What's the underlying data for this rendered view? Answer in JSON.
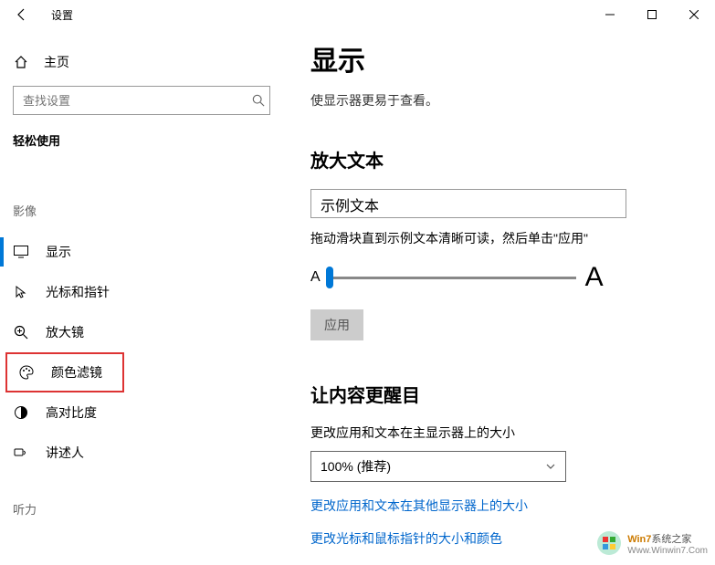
{
  "titlebar": {
    "app_name": "设置"
  },
  "sidebar": {
    "home_label": "主页",
    "search_placeholder": "查找设置",
    "section_label": "轻松使用",
    "category_vision": "影像",
    "category_hearing": "听力",
    "items": [
      {
        "label": "显示"
      },
      {
        "label": "光标和指针"
      },
      {
        "label": "放大镜"
      },
      {
        "label": "颜色滤镜"
      },
      {
        "label": "高对比度"
      },
      {
        "label": "讲述人"
      }
    ]
  },
  "content": {
    "page_title": "显示",
    "page_desc": "使显示器更易于查看。",
    "section_enlarge_text": "放大文本",
    "sample_text": "示例文本",
    "slider_hint": "拖动滑块直到示例文本清晰可读，然后单击\"应用\"",
    "apply_label": "应用",
    "section_bigger": "让内容更醒目",
    "scale_label": "更改应用和文本在主显示器上的大小",
    "scale_value": "100% (推荐)",
    "link_other_displays": "更改应用和文本在其他显示器上的大小",
    "link_cursor": "更改光标和鼠标指针的大小和颜色"
  },
  "watermark": {
    "line1_a": "Win7",
    "line1_b": "系统之家",
    "line2": "Www.Winwin7.Com"
  }
}
